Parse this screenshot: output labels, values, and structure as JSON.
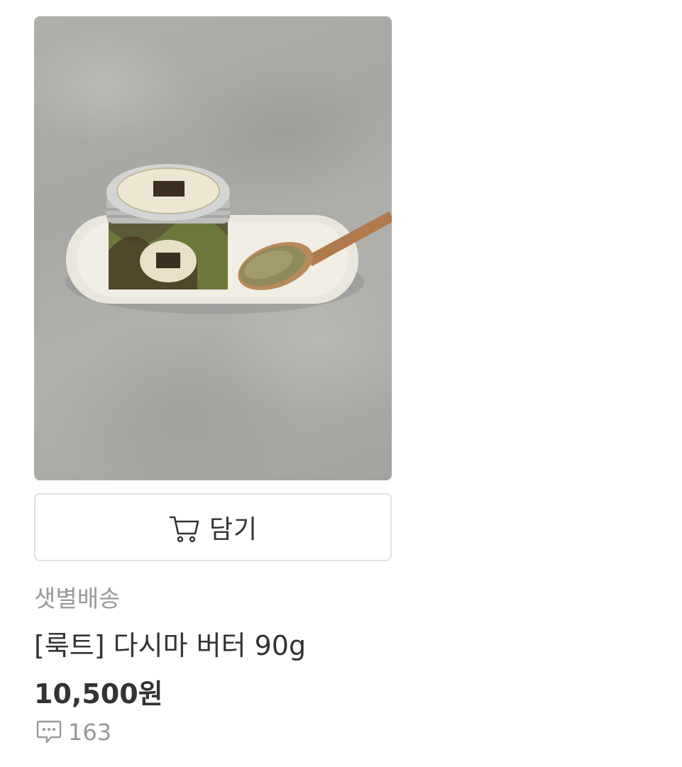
{
  "product": {
    "image_icon": "product-photo",
    "cart_button_label": "담기",
    "cart_icon": "cart-icon",
    "delivery_type": "샛별배송",
    "title": "[룩트] 다시마 버터 90g",
    "price": "10,500원",
    "review_icon": "comment-icon",
    "review_count": "163"
  }
}
